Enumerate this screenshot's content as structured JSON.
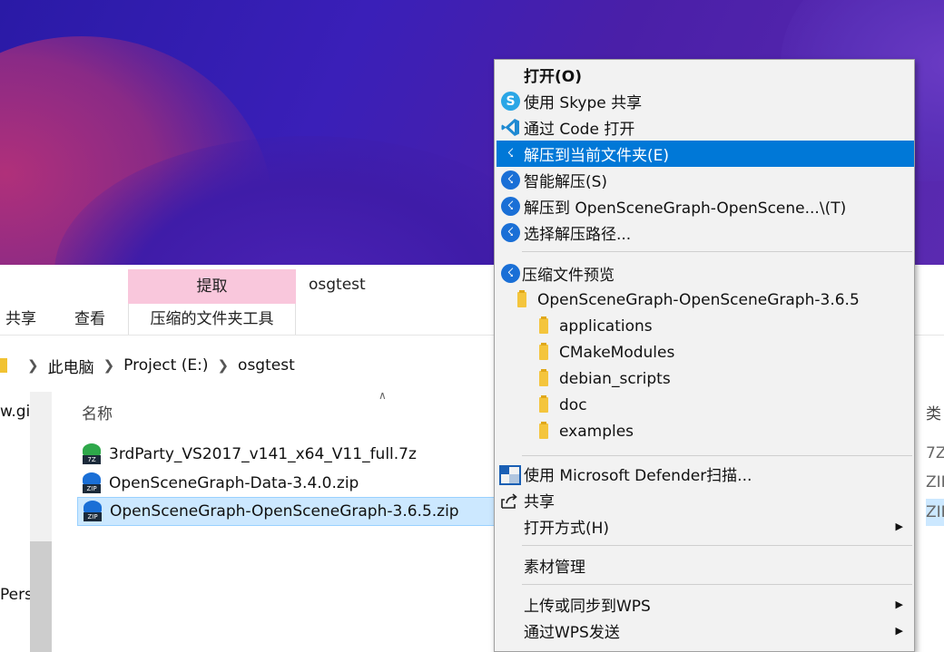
{
  "explorer": {
    "window_title": "osgtest",
    "ribbon": {
      "context_header": "提取",
      "context_tool": "压缩的文件夹工具",
      "tabs": [
        "共享",
        "查看"
      ]
    },
    "address": {
      "crumbs": [
        "此电脑",
        "Project (E:)",
        "osgtest"
      ]
    },
    "nav_pane": {
      "item_top": "w.gi",
      "item_bottom": "Perso"
    },
    "list": {
      "col_name": "名称",
      "col_type": "类",
      "files": [
        {
          "name": "3rdParty_VS2017_v141_x64_V11_full.7z",
          "icon_tag": "7Z",
          "type": "7Z"
        },
        {
          "name": "OpenSceneGraph-Data-3.4.0.zip",
          "icon_tag": "ZIP",
          "type": "ZIP"
        },
        {
          "name": "OpenSceneGraph-OpenSceneGraph-3.6.5.zip",
          "icon_tag": "ZIP",
          "type": "ZIP",
          "selected": true
        }
      ]
    }
  },
  "context_menu": {
    "items": [
      {
        "label": "打开(O)",
        "icon": "none"
      },
      {
        "label": "使用 Skype 共享",
        "icon": "skype-icon"
      },
      {
        "label": "通过 Code 打开",
        "icon": "vscode-icon"
      },
      {
        "label": "解压到当前文件夹(E)",
        "icon": "bandizip-icon",
        "highlighted": true
      },
      {
        "label": "智能解压(S)",
        "icon": "bandizip-icon"
      },
      {
        "label": "解压到 OpenSceneGraph-OpenScene...\\(T)",
        "icon": "bandizip-icon"
      },
      {
        "label": "选择解压路径...",
        "icon": "bandizip-icon"
      },
      {
        "label": "压缩文件预览",
        "icon": "bandizip-icon"
      },
      {
        "label": "OpenSceneGraph-OpenSceneGraph-3.6.5",
        "icon": "folder-icon"
      },
      {
        "label": "applications",
        "icon": "folder-icon"
      },
      {
        "label": "CMakeModules",
        "icon": "folder-icon"
      },
      {
        "label": "debian_scripts",
        "icon": "folder-icon"
      },
      {
        "label": "doc",
        "icon": "folder-icon"
      },
      {
        "label": "examples",
        "icon": "folder-icon"
      },
      {
        "label": "使用 Microsoft Defender扫描...",
        "icon": "defender-icon"
      },
      {
        "label": "共享",
        "icon": "share-icon"
      },
      {
        "label": "打开方式(H)",
        "icon": "none",
        "submenu": true
      },
      {
        "label": "素材管理",
        "icon": "none"
      },
      {
        "label": "上传或同步到WPS",
        "icon": "none",
        "submenu": true
      },
      {
        "label": "通过WPS发送",
        "icon": "none",
        "submenu": true
      }
    ]
  },
  "colors": {
    "highlight": "#0078d7",
    "selected_row": "#cce8ff",
    "context_tab": "#f9c7dc",
    "bandizip_blue": "#1a6fd6"
  }
}
